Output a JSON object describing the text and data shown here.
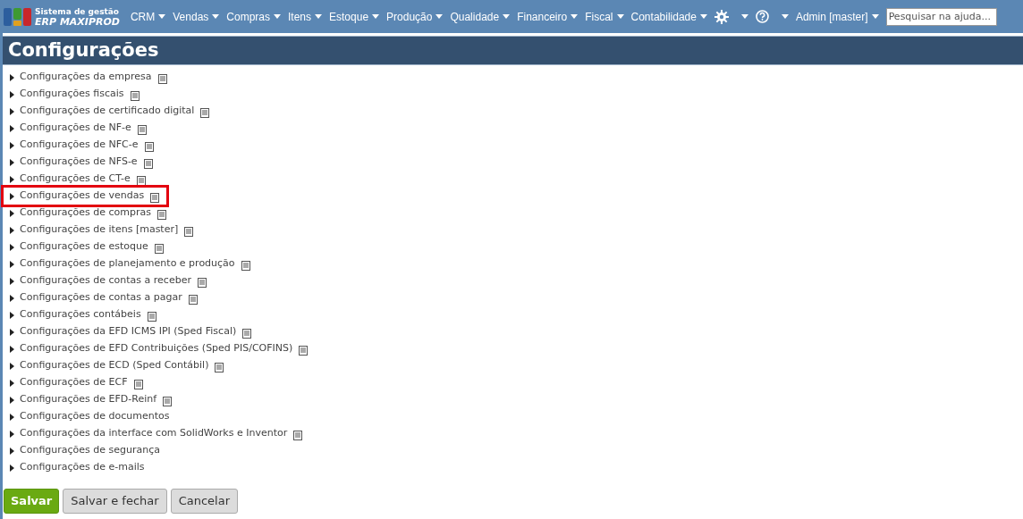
{
  "logo": {
    "line1": "Sistema de gestão",
    "line2": "ERP MAXIPROD"
  },
  "menu": [
    {
      "label": "CRM",
      "kind": "text"
    },
    {
      "label": "Vendas",
      "kind": "text"
    },
    {
      "label": "Compras",
      "kind": "text"
    },
    {
      "label": "Itens",
      "kind": "text"
    },
    {
      "label": "Estoque",
      "kind": "text"
    },
    {
      "label": "Produção",
      "kind": "text"
    },
    {
      "label": "Qualidade",
      "kind": "text"
    },
    {
      "label": "Financeiro",
      "kind": "text"
    },
    {
      "label": "Fiscal",
      "kind": "text"
    },
    {
      "label": "Contabilidade",
      "kind": "text"
    },
    {
      "kind": "settings"
    },
    {
      "kind": "help"
    },
    {
      "label": "Admin [master]",
      "kind": "text"
    }
  ],
  "search": {
    "placeholder": "Pesquisar na ajuda..."
  },
  "title": "Configurações",
  "items": [
    {
      "label": "Configurações da empresa",
      "has_note": true,
      "highlighted": false
    },
    {
      "label": "Configurações fiscais",
      "has_note": true,
      "highlighted": false
    },
    {
      "label": "Configurações de certificado digital",
      "has_note": true,
      "highlighted": false
    },
    {
      "label": "Configurações de NF-e",
      "has_note": true,
      "highlighted": false
    },
    {
      "label": "Configurações de NFC-e",
      "has_note": true,
      "highlighted": false
    },
    {
      "label": "Configurações de NFS-e",
      "has_note": true,
      "highlighted": false
    },
    {
      "label": "Configurações de CT-e",
      "has_note": true,
      "highlighted": false
    },
    {
      "label": "Configurações de vendas",
      "has_note": true,
      "highlighted": true
    },
    {
      "label": "Configurações de compras",
      "has_note": true,
      "highlighted": false
    },
    {
      "label": "Configurações de itens [master]",
      "has_note": true,
      "highlighted": false
    },
    {
      "label": "Configurações de estoque",
      "has_note": true,
      "highlighted": false
    },
    {
      "label": "Configurações de planejamento e produção",
      "has_note": true,
      "highlighted": false
    },
    {
      "label": "Configurações de contas a receber",
      "has_note": true,
      "highlighted": false
    },
    {
      "label": "Configurações de contas a pagar",
      "has_note": true,
      "highlighted": false
    },
    {
      "label": "Configurações contábeis",
      "has_note": true,
      "highlighted": false
    },
    {
      "label": "Configurações da EFD ICMS IPI (Sped Fiscal)",
      "has_note": true,
      "highlighted": false
    },
    {
      "label": "Configurações de EFD Contribuições (Sped PIS/COFINS)",
      "has_note": true,
      "highlighted": false
    },
    {
      "label": "Configurações de ECD (Sped Contábil)",
      "has_note": true,
      "highlighted": false
    },
    {
      "label": "Configurações de ECF",
      "has_note": true,
      "highlighted": false
    },
    {
      "label": "Configurações de EFD-Reinf",
      "has_note": true,
      "highlighted": false
    },
    {
      "label": "Configurações de documentos",
      "has_note": false,
      "highlighted": false
    },
    {
      "label": "Configurações da interface com SolidWorks e Inventor",
      "has_note": true,
      "highlighted": false
    },
    {
      "label": "Configurações de segurança",
      "has_note": false,
      "highlighted": false
    },
    {
      "label": "Configurações de e-mails",
      "has_note": false,
      "highlighted": false
    }
  ],
  "buttons": [
    {
      "label": "Salvar",
      "kind": "primary"
    },
    {
      "label": "Salvar e fechar",
      "kind": "secondary"
    },
    {
      "label": "Cancelar",
      "kind": "secondary"
    }
  ]
}
